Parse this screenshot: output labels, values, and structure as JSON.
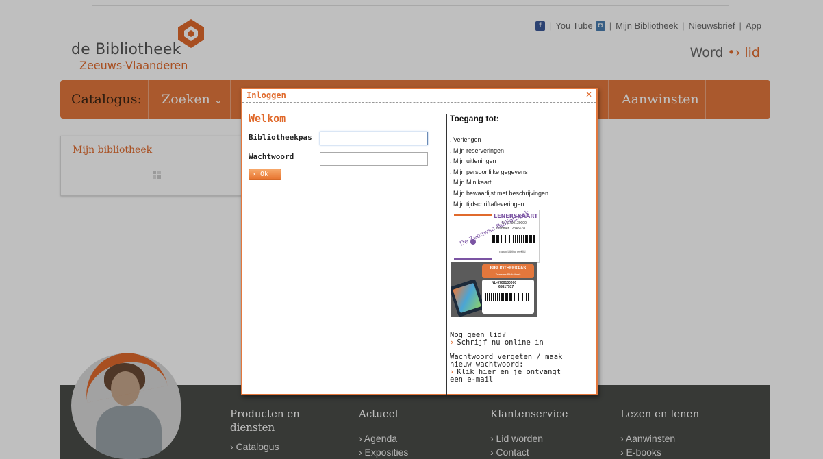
{
  "header": {
    "logo_line1": "de Bibliotheek",
    "logo_line2": "Zeeuws-Vlaanderen",
    "facebook_icon": "f",
    "youtube_label": "You Tube",
    "instagram_icon": "◘",
    "mijn_bibliotheek": "Mijn Bibliotheek",
    "nieuwsbrief": "Nieuwsbrief",
    "app": "App",
    "separator": "|",
    "word_label": "Word",
    "word_arrow": "•›",
    "lid_label": "lid"
  },
  "nav": {
    "catalogus": "Catalogus:",
    "zoeken": "Zoeken",
    "zoeken_chevron": "⌄",
    "aanwinsten": "Aanwinsten"
  },
  "sidebar": {
    "mijn_bibliotheek_title": "Mijn bibliotheek"
  },
  "footer": {
    "columns": [
      {
        "heading": "Producten en diensten",
        "links": [
          "› Catalogus"
        ]
      },
      {
        "heading": "Actueel",
        "links": [
          "› Agenda",
          "› Exposities"
        ]
      },
      {
        "heading": "Klantenservice",
        "links": [
          "› Lid worden",
          "› Contact"
        ]
      },
      {
        "heading": "Lezen en lenen",
        "links": [
          "› Aanwinsten",
          "› E-books"
        ]
      }
    ]
  },
  "modal": {
    "title": "Inloggen",
    "close_icon": "✕",
    "welcome": "Welkom",
    "field_pas_label": "Bibliotheekpas",
    "field_pas_value": "",
    "field_ww_label": "Wachtwoord",
    "field_ww_value": "",
    "ok_button": "› Ok",
    "toegang_title": "Toegang tot:",
    "toegang_items": [
      ". Verlengen",
      ". Mijn reserveringen",
      ". Mijn uitleningen",
      ". Mijn persoonlijke gegevens",
      ". Mijn Minikaart",
      ". Mijn bewaarlijst met beschrijvingen",
      ". Mijn tijdschriftafleveringen"
    ],
    "card1": {
      "title": "LENERSKAART",
      "number": "NL-0700130000",
      "nummer": "nummer 12345678",
      "brand": "De Zeeuwse Bibliotheek",
      "naam": "naam bibliotheeklid"
    },
    "card2": {
      "title": "BIBLIOTHEEKPAS",
      "subtitle": "Zeeuwse Bibliotheek",
      "number1": "NL-0700130000",
      "number2": "65817517"
    },
    "nog_geen_lid": "Nog geen lid?",
    "schrijf_in": "Schrijf nu online in",
    "ww_vergeten_1": "Wachtwoord vergeten / maak",
    "ww_vergeten_2": "nieuw wachtwoord:",
    "klik_hier": "Klik hier en je ontvangt",
    "een_email": "een e-mail",
    "arrow": "›"
  }
}
